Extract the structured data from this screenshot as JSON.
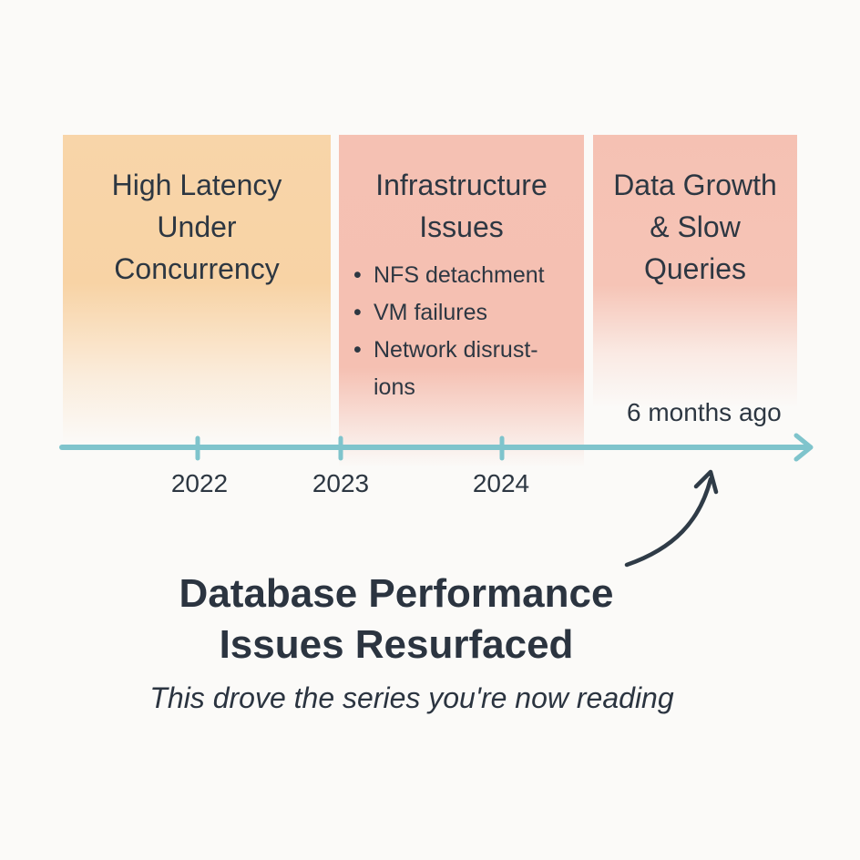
{
  "panels": [
    {
      "title": "High Latency\nUnder\nConcurrency",
      "color": "#f8d5a9"
    },
    {
      "title": "Infrastructure\nIssues",
      "color": "#f5c1b3",
      "bullets": [
        "NFS detachment",
        "VM failures",
        "Network disrust-\nions"
      ]
    },
    {
      "title": "Data Growth\n& Slow\nQueries",
      "color": "#f5c1b3"
    }
  ],
  "timeline": {
    "years": [
      "2022",
      "2023",
      "2024"
    ],
    "marker_label": "6 months ago",
    "axis_color": "#7fc4cc"
  },
  "headline": "Database Performance\nIssues Resurfaced",
  "subline": "This drove the series you're now reading"
}
